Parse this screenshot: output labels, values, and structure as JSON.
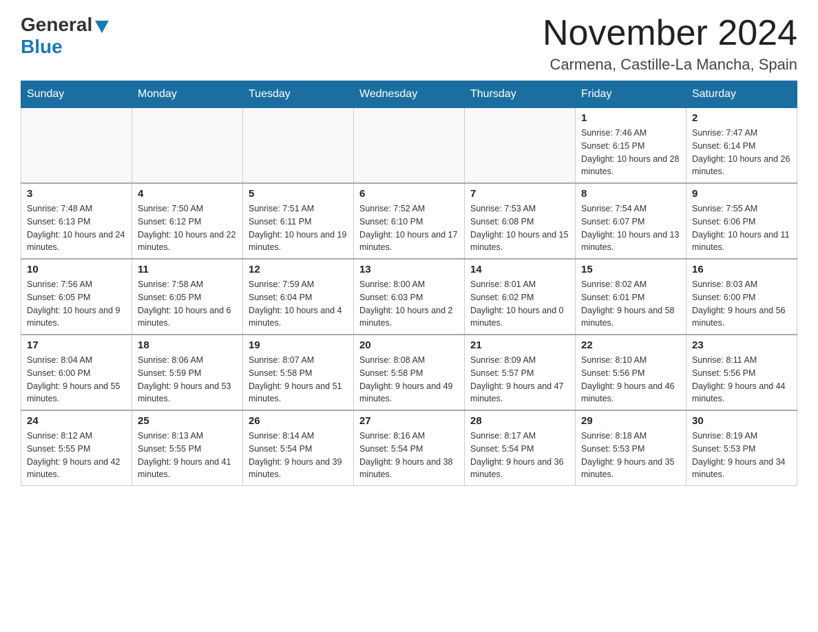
{
  "header": {
    "logo_general": "General",
    "logo_blue": "Blue",
    "month_title": "November 2024",
    "location": "Carmena, Castille-La Mancha, Spain"
  },
  "days_of_week": [
    "Sunday",
    "Monday",
    "Tuesday",
    "Wednesday",
    "Thursday",
    "Friday",
    "Saturday"
  ],
  "weeks": [
    {
      "days": [
        {
          "number": "",
          "info": ""
        },
        {
          "number": "",
          "info": ""
        },
        {
          "number": "",
          "info": ""
        },
        {
          "number": "",
          "info": ""
        },
        {
          "number": "",
          "info": ""
        },
        {
          "number": "1",
          "info": "Sunrise: 7:46 AM\nSunset: 6:15 PM\nDaylight: 10 hours and 28 minutes."
        },
        {
          "number": "2",
          "info": "Sunrise: 7:47 AM\nSunset: 6:14 PM\nDaylight: 10 hours and 26 minutes."
        }
      ]
    },
    {
      "days": [
        {
          "number": "3",
          "info": "Sunrise: 7:48 AM\nSunset: 6:13 PM\nDaylight: 10 hours and 24 minutes."
        },
        {
          "number": "4",
          "info": "Sunrise: 7:50 AM\nSunset: 6:12 PM\nDaylight: 10 hours and 22 minutes."
        },
        {
          "number": "5",
          "info": "Sunrise: 7:51 AM\nSunset: 6:11 PM\nDaylight: 10 hours and 19 minutes."
        },
        {
          "number": "6",
          "info": "Sunrise: 7:52 AM\nSunset: 6:10 PM\nDaylight: 10 hours and 17 minutes."
        },
        {
          "number": "7",
          "info": "Sunrise: 7:53 AM\nSunset: 6:08 PM\nDaylight: 10 hours and 15 minutes."
        },
        {
          "number": "8",
          "info": "Sunrise: 7:54 AM\nSunset: 6:07 PM\nDaylight: 10 hours and 13 minutes."
        },
        {
          "number": "9",
          "info": "Sunrise: 7:55 AM\nSunset: 6:06 PM\nDaylight: 10 hours and 11 minutes."
        }
      ]
    },
    {
      "days": [
        {
          "number": "10",
          "info": "Sunrise: 7:56 AM\nSunset: 6:05 PM\nDaylight: 10 hours and 9 minutes."
        },
        {
          "number": "11",
          "info": "Sunrise: 7:58 AM\nSunset: 6:05 PM\nDaylight: 10 hours and 6 minutes."
        },
        {
          "number": "12",
          "info": "Sunrise: 7:59 AM\nSunset: 6:04 PM\nDaylight: 10 hours and 4 minutes."
        },
        {
          "number": "13",
          "info": "Sunrise: 8:00 AM\nSunset: 6:03 PM\nDaylight: 10 hours and 2 minutes."
        },
        {
          "number": "14",
          "info": "Sunrise: 8:01 AM\nSunset: 6:02 PM\nDaylight: 10 hours and 0 minutes."
        },
        {
          "number": "15",
          "info": "Sunrise: 8:02 AM\nSunset: 6:01 PM\nDaylight: 9 hours and 58 minutes."
        },
        {
          "number": "16",
          "info": "Sunrise: 8:03 AM\nSunset: 6:00 PM\nDaylight: 9 hours and 56 minutes."
        }
      ]
    },
    {
      "days": [
        {
          "number": "17",
          "info": "Sunrise: 8:04 AM\nSunset: 6:00 PM\nDaylight: 9 hours and 55 minutes."
        },
        {
          "number": "18",
          "info": "Sunrise: 8:06 AM\nSunset: 5:59 PM\nDaylight: 9 hours and 53 minutes."
        },
        {
          "number": "19",
          "info": "Sunrise: 8:07 AM\nSunset: 5:58 PM\nDaylight: 9 hours and 51 minutes."
        },
        {
          "number": "20",
          "info": "Sunrise: 8:08 AM\nSunset: 5:58 PM\nDaylight: 9 hours and 49 minutes."
        },
        {
          "number": "21",
          "info": "Sunrise: 8:09 AM\nSunset: 5:57 PM\nDaylight: 9 hours and 47 minutes."
        },
        {
          "number": "22",
          "info": "Sunrise: 8:10 AM\nSunset: 5:56 PM\nDaylight: 9 hours and 46 minutes."
        },
        {
          "number": "23",
          "info": "Sunrise: 8:11 AM\nSunset: 5:56 PM\nDaylight: 9 hours and 44 minutes."
        }
      ]
    },
    {
      "days": [
        {
          "number": "24",
          "info": "Sunrise: 8:12 AM\nSunset: 5:55 PM\nDaylight: 9 hours and 42 minutes."
        },
        {
          "number": "25",
          "info": "Sunrise: 8:13 AM\nSunset: 5:55 PM\nDaylight: 9 hours and 41 minutes."
        },
        {
          "number": "26",
          "info": "Sunrise: 8:14 AM\nSunset: 5:54 PM\nDaylight: 9 hours and 39 minutes."
        },
        {
          "number": "27",
          "info": "Sunrise: 8:16 AM\nSunset: 5:54 PM\nDaylight: 9 hours and 38 minutes."
        },
        {
          "number": "28",
          "info": "Sunrise: 8:17 AM\nSunset: 5:54 PM\nDaylight: 9 hours and 36 minutes."
        },
        {
          "number": "29",
          "info": "Sunrise: 8:18 AM\nSunset: 5:53 PM\nDaylight: 9 hours and 35 minutes."
        },
        {
          "number": "30",
          "info": "Sunrise: 8:19 AM\nSunset: 5:53 PM\nDaylight: 9 hours and 34 minutes."
        }
      ]
    }
  ]
}
